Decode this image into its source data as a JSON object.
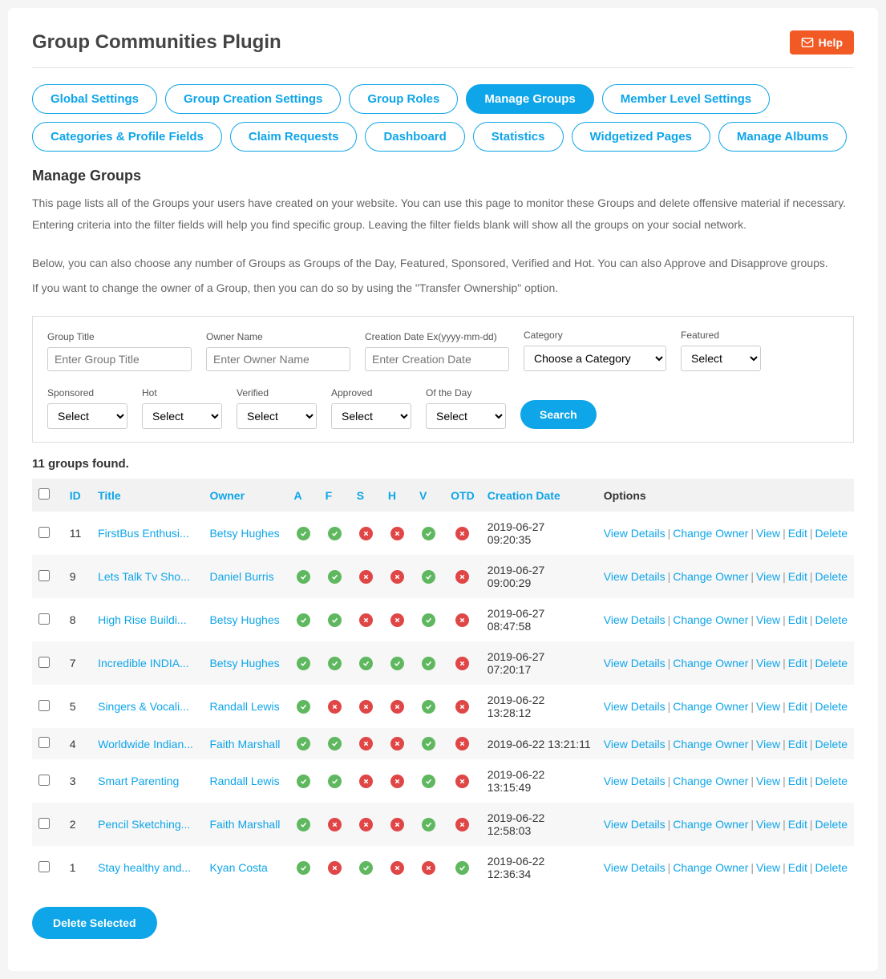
{
  "header": {
    "title": "Group Communities Plugin",
    "help_label": "Help"
  },
  "tabs": [
    {
      "label": "Global Settings",
      "active": false
    },
    {
      "label": "Group Creation Settings",
      "active": false
    },
    {
      "label": "Group Roles",
      "active": false
    },
    {
      "label": "Manage Groups",
      "active": true
    },
    {
      "label": "Member Level Settings",
      "active": false
    },
    {
      "label": "Categories & Profile Fields",
      "active": false
    },
    {
      "label": "Claim Requests",
      "active": false
    },
    {
      "label": "Dashboard",
      "active": false
    },
    {
      "label": "Statistics",
      "active": false
    },
    {
      "label": "Widgetized Pages",
      "active": false
    },
    {
      "label": "Manage Albums",
      "active": false
    }
  ],
  "section": {
    "title": "Manage Groups",
    "desc1": "This page lists all of the Groups your users have created on your website. You can use this page to monitor these Groups and delete offensive material if necessary. Entering criteria into the filter fields will help you find specific group. Leaving the filter fields blank will show all the groups on your social network.",
    "desc2": "Below, you can also choose any number of Groups as Groups of the Day, Featured, Sponsored, Verified and Hot. You can also Approve and Disapprove groups.",
    "desc3": "If you want to change the owner of a Group, then you can do so by using the \"Transfer Ownership\" option."
  },
  "filters": {
    "group_title": {
      "label": "Group Title",
      "placeholder": "Enter Group Title"
    },
    "owner_name": {
      "label": "Owner Name",
      "placeholder": "Enter Owner Name"
    },
    "creation_date": {
      "label": "Creation Date Ex(yyyy-mm-dd)",
      "placeholder": "Enter Creation Date"
    },
    "category": {
      "label": "Category",
      "selected": "Choose a Category"
    },
    "featured": {
      "label": "Featured",
      "selected": "Select"
    },
    "sponsored": {
      "label": "Sponsored",
      "selected": "Select"
    },
    "hot": {
      "label": "Hot",
      "selected": "Select"
    },
    "verified": {
      "label": "Verified",
      "selected": "Select"
    },
    "approved": {
      "label": "Approved",
      "selected": "Select"
    },
    "of_the_day": {
      "label": "Of the Day",
      "selected": "Select"
    },
    "search_label": "Search"
  },
  "results": {
    "count_text": "11 groups found.",
    "columns": {
      "id": "ID",
      "title": "Title",
      "owner": "Owner",
      "a": "A",
      "f": "F",
      "s": "S",
      "h": "H",
      "v": "V",
      "otd": "OTD",
      "date": "Creation Date",
      "options": "Options"
    },
    "option_labels": {
      "view_details": "View Details",
      "change_owner": "Change Owner",
      "view": "View",
      "edit": "Edit",
      "delete": "Delete"
    },
    "rows": [
      {
        "id": "11",
        "title": "FirstBus Enthusi...",
        "owner": "Betsy Hughes",
        "a": true,
        "f": true,
        "s": false,
        "h": false,
        "v": true,
        "otd": false,
        "date": "2019-06-27 09:20:35"
      },
      {
        "id": "9",
        "title": "Lets Talk Tv Sho...",
        "owner": "Daniel Burris",
        "a": true,
        "f": true,
        "s": false,
        "h": false,
        "v": true,
        "otd": false,
        "date": "2019-06-27 09:00:29"
      },
      {
        "id": "8",
        "title": "High Rise Buildi...",
        "owner": "Betsy Hughes",
        "a": true,
        "f": true,
        "s": false,
        "h": false,
        "v": true,
        "otd": false,
        "date": "2019-06-27 08:47:58"
      },
      {
        "id": "7",
        "title": "Incredible INDIA...",
        "owner": "Betsy Hughes",
        "a": true,
        "f": true,
        "s": true,
        "h": true,
        "v": true,
        "otd": false,
        "date": "2019-06-27 07:20:17"
      },
      {
        "id": "5",
        "title": "Singers & Vocali...",
        "owner": "Randall Lewis",
        "a": true,
        "f": false,
        "s": false,
        "h": false,
        "v": true,
        "otd": false,
        "date": "2019-06-22 13:28:12"
      },
      {
        "id": "4",
        "title": "Worldwide Indian...",
        "owner": "Faith Marshall",
        "a": true,
        "f": true,
        "s": false,
        "h": false,
        "v": true,
        "otd": false,
        "date": "2019-06-22 13:21:11"
      },
      {
        "id": "3",
        "title": "Smart Parenting",
        "owner": "Randall Lewis",
        "a": true,
        "f": true,
        "s": false,
        "h": false,
        "v": true,
        "otd": false,
        "date": "2019-06-22 13:15:49"
      },
      {
        "id": "2",
        "title": "Pencil Sketching...",
        "owner": "Faith Marshall",
        "a": true,
        "f": false,
        "s": false,
        "h": false,
        "v": true,
        "otd": false,
        "date": "2019-06-22 12:58:03"
      },
      {
        "id": "1",
        "title": "Stay healthy and...",
        "owner": "Kyan Costa",
        "a": true,
        "f": false,
        "s": true,
        "h": false,
        "v": false,
        "otd": true,
        "date": "2019-06-22 12:36:34"
      }
    ]
  },
  "footer": {
    "delete_selected_label": "Delete Selected"
  }
}
